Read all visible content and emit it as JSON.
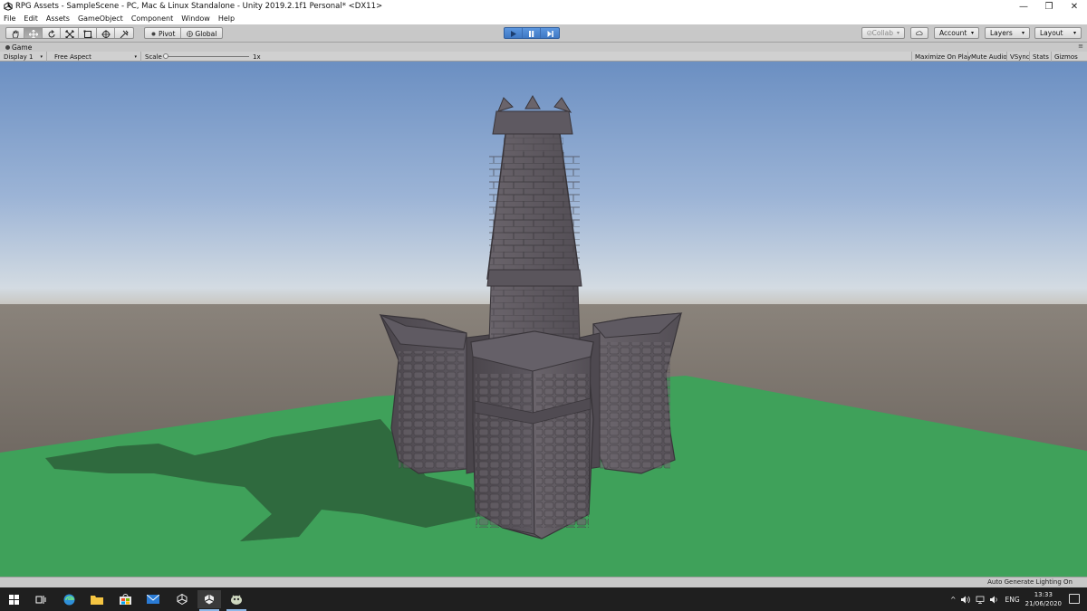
{
  "window": {
    "title": "RPG Assets - SampleScene - PC, Mac & Linux Standalone - Unity 2019.2.1f1 Personal* <DX11>",
    "minimize_glyph": "—",
    "restore_glyph": "❐",
    "close_glyph": "✕"
  },
  "menu": {
    "items": [
      "File",
      "Edit",
      "Assets",
      "GameObject",
      "Component",
      "Window",
      "Help"
    ]
  },
  "toolbar": {
    "pivot_label": "Pivot",
    "global_label": "Global",
    "collab_label": "Collab",
    "account_label": "Account",
    "layers_label": "Layers",
    "layout_label": "Layout",
    "dropdown_arrow": "▾"
  },
  "game_view": {
    "tab_label": "Game",
    "tab_menu_glyph": "≡",
    "display_label": "Display 1",
    "aspect_label": "Free Aspect",
    "scale_label": "Scale",
    "scale_value": "1x",
    "scale_fraction": 0.0,
    "maximize_on_play": "Maximize On Play",
    "mute_audio": "Mute Audio",
    "vsync": "VSync",
    "stats": "Stats",
    "gizmos": "Gizmos"
  },
  "status": {
    "text": "Auto Generate Lighting On"
  },
  "taskbar": {
    "icons": [
      "windows-start-icon",
      "task-view-icon",
      "edge-icon",
      "file-explorer-icon",
      "store-icon",
      "mail-icon",
      "unity-hub-icon",
      "unity-editor-icon",
      "game-app-icon"
    ],
    "language": "ENG",
    "time": "13:33",
    "date": "21/06/2020",
    "tray_chevron": "^"
  },
  "colors": {
    "sky_top": "#6f92c4",
    "horizon": "#c8d4df",
    "ground": "#6c645d",
    "grass": "#3fa15a",
    "stone": "#585358",
    "accent_play": "#4a86d2"
  }
}
